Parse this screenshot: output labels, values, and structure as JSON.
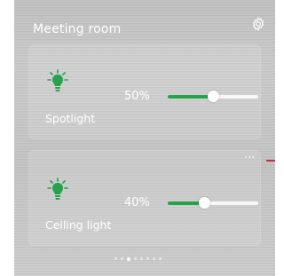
{
  "room": {
    "title": "Meeting room",
    "settings_icon": "gear-icon"
  },
  "devices": [
    {
      "name": "Spotlight",
      "brightness_label": "50%",
      "brightness": 0.5,
      "icon": "lightbulb-icon"
    },
    {
      "name": "Ceiling light",
      "brightness_label": "40%",
      "brightness": 0.4,
      "icon": "lightbulb-icon"
    }
  ],
  "more_menu": {
    "label": "···",
    "icon": "more-icon"
  },
  "pagination": {
    "count": 8,
    "active_index": 2
  },
  "colors": {
    "accent": "#25a24a",
    "track": "#ffffff",
    "highlight_line": "#c0334d"
  }
}
